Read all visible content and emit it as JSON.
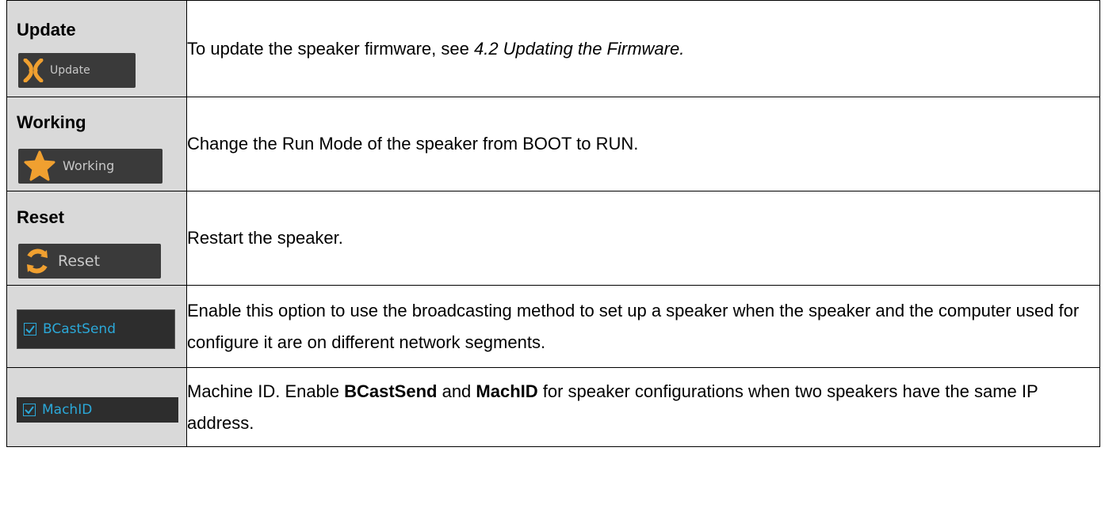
{
  "rows": [
    {
      "label": "Update",
      "button_text": "Update",
      "icon": "update-icon",
      "desc_prefix": "To update the speaker firmware, see ",
      "desc_link": "4.2 Updating the Firmware."
    },
    {
      "label": "Working",
      "button_text": "Working",
      "icon": "star-icon",
      "desc": "Change the Run Mode of the speaker from BOOT to RUN."
    },
    {
      "label": "Reset",
      "button_text": "Reset",
      "icon": "refresh-icon",
      "desc": "Restart the speaker."
    },
    {
      "checkbox_text": "BCastSend",
      "checked": true,
      "desc": "Enable this option to use the broadcasting method to set up a speaker when the speaker and the computer used for configure it are on different network segments."
    },
    {
      "checkbox_text": "MachID",
      "checked": true,
      "desc_p1": "Machine ID. Enable ",
      "desc_b1": "BCastSend",
      "desc_p2": " and ",
      "desc_b2": "MachID",
      "desc_p3": " for speaker configurations when two speakers have the same IP address."
    }
  ],
  "colors": {
    "label_bg": "#d9d9d9",
    "button_bg": "#3a3a3a",
    "icon_orange": "#f0a030",
    "checkbox_blue": "#2ba8d8"
  }
}
